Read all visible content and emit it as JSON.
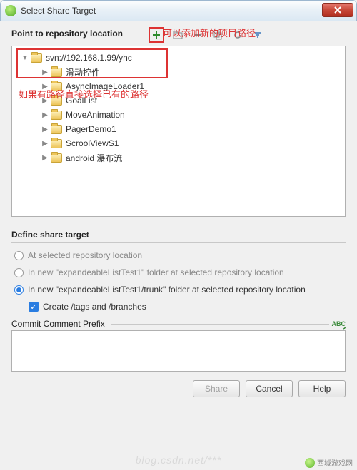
{
  "title": "Select Share Target",
  "annotations": {
    "top": "可以添加新的项目路径",
    "left": "如果有路径直接选择已有的路径"
  },
  "sections": {
    "repo_label": "Point to repository location"
  },
  "tree": {
    "root": "svn://192.168.1.99/yhc",
    "children": [
      "滑动控件",
      "AsyncImageLoader1",
      "GoalList",
      "MoveAnimation",
      "PagerDemo1",
      "ScroolViewS1",
      "android 瀑布流"
    ]
  },
  "define": {
    "label": "Define share target",
    "opt1": "At selected repository location",
    "opt2": "In new \"expandeableListTest1\" folder at selected repository location",
    "opt3": "In new \"expandeableListTest1/trunk\" folder at selected repository location",
    "check": "Create /tags and /branches"
  },
  "commit": {
    "label": "Commit Comment Prefix",
    "abc": "ABC"
  },
  "buttons": {
    "share": "Share",
    "cancel": "Cancel",
    "help": "Help"
  },
  "watermark": {
    "site": "西域游戏网",
    "text": "blog.csdn.net/***"
  }
}
